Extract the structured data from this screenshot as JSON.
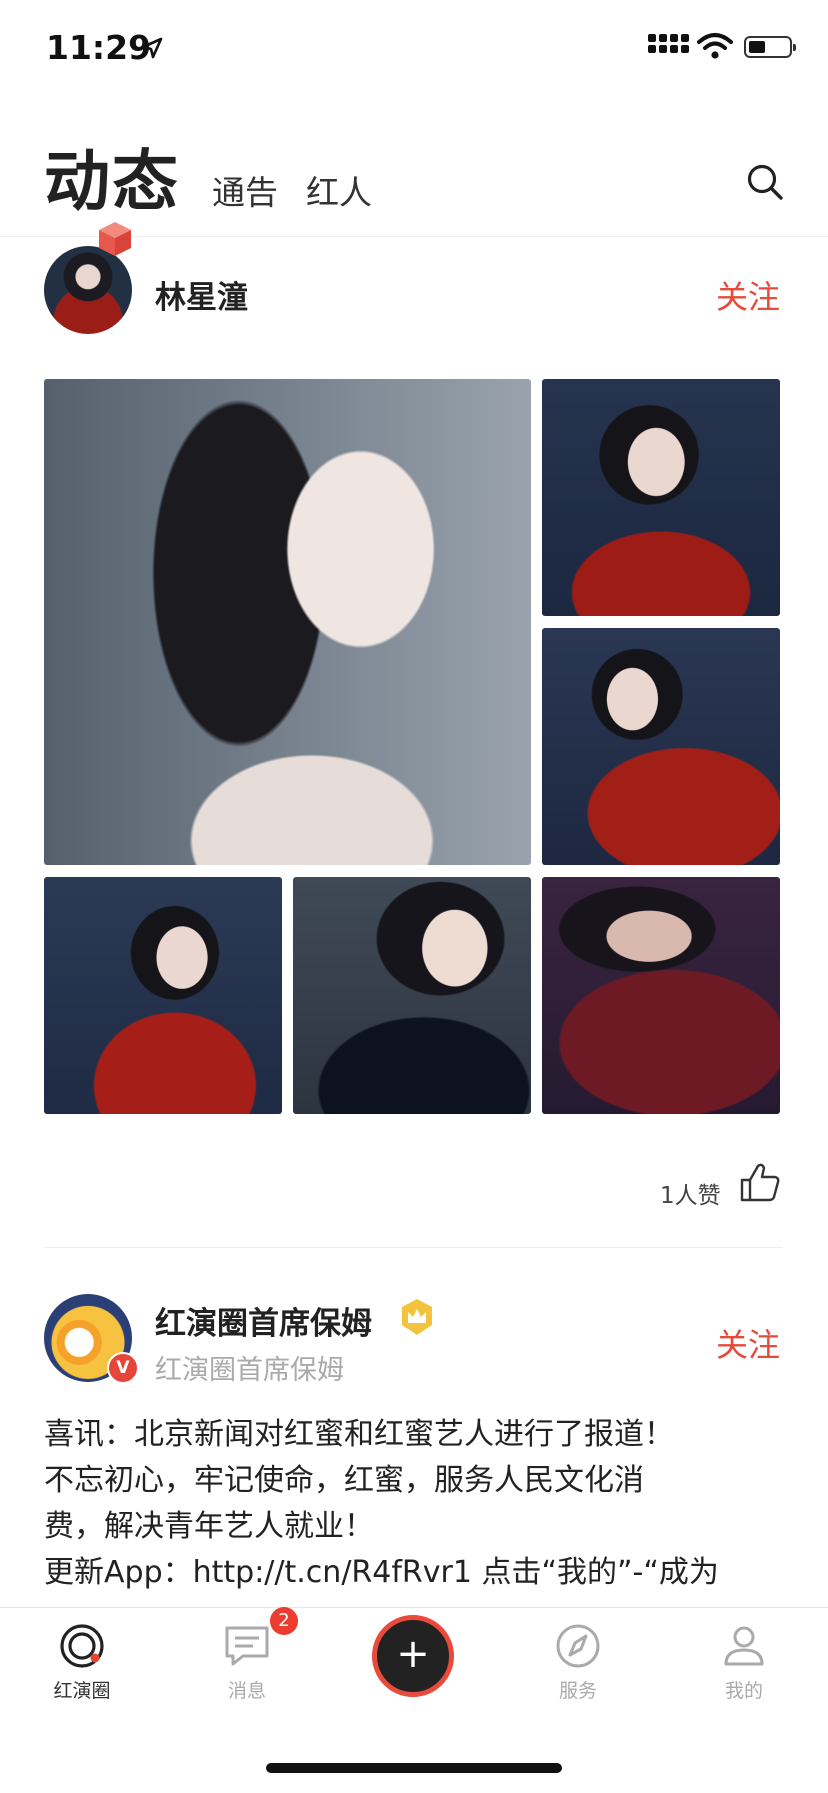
{
  "status_bar": {
    "time": "11:29"
  },
  "header": {
    "title": "动态",
    "tabs": [
      "通告",
      "红人"
    ]
  },
  "post1": {
    "author": "林星潼",
    "follow_label": "关注",
    "likes_text": "1人赞"
  },
  "post2": {
    "author": "红演圈首席保姆",
    "subtitle": "红演圈首席保姆",
    "verified_badge": "V",
    "follow_label": "关注",
    "text_lines": [
      "喜讯：北京新闻对红蜜和红蜜艺人进行了报道！",
      "不忘初心，牢记使命，红蜜，服务人民文化消",
      "费，解决青年艺人就业！",
      "更新App：http://t.cn/R4fRvr1 点击“我的”-“成为"
    ]
  },
  "tabbar": {
    "items": [
      {
        "label": "红演圈",
        "icon": "circle-logo-icon",
        "active": true
      },
      {
        "label": "消息",
        "icon": "message-icon",
        "badge": "2"
      },
      {
        "label": "",
        "icon": "plus-icon"
      },
      {
        "label": "服务",
        "icon": "compass-icon"
      },
      {
        "label": "我的",
        "icon": "profile-icon"
      }
    ]
  },
  "colors": {
    "accent": "#e44b3a",
    "badge": "#ec3b2f",
    "text": "#222222",
    "muted": "#aaaaaa"
  }
}
